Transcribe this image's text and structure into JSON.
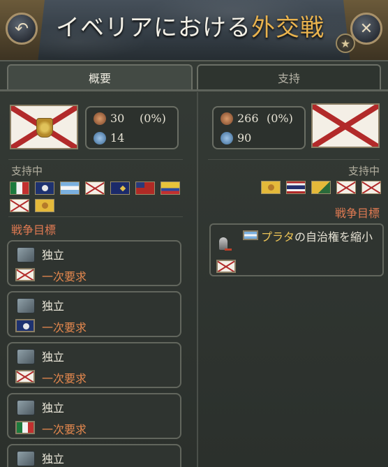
{
  "header": {
    "title_prefix": "イベリアにおける",
    "title_highlight": "外交戦",
    "back_glyph": "↶",
    "close_glyph": "✕",
    "star_glyph": "★"
  },
  "tabs": [
    {
      "label": "概要",
      "active": true
    },
    {
      "label": "支持",
      "active": false
    }
  ],
  "left_side": {
    "army": "30",
    "army_pct": "(0%)",
    "navy": "14",
    "supporters_label": "支持中",
    "supporter_flags": [
      "mexico",
      "navy",
      "argentina",
      "burgundy",
      "ensign",
      "redensign",
      "ecuador",
      "burgundy",
      "yellow"
    ],
    "wargoals_label": "戦争目標",
    "wargoals": [
      {
        "type": "独立",
        "demand": "一次要求",
        "flag": "burgundy"
      },
      {
        "type": "独立",
        "demand": "一次要求",
        "flag": "navy"
      },
      {
        "type": "独立",
        "demand": "一次要求",
        "flag": "burgundy"
      },
      {
        "type": "独立",
        "demand": "一次要求",
        "flag": "mexico"
      },
      {
        "type": "独立",
        "demand": "",
        "flag": ""
      }
    ]
  },
  "right_side": {
    "army": "266",
    "army_pct": "(0%)",
    "navy": "90",
    "supporters_label": "支持中",
    "supporter_flags": [
      "yellow",
      "thai",
      "yellow2",
      "burgundy",
      "burgundy"
    ],
    "wargoals_label": "戦争目標",
    "wargoal": {
      "target": "プラタ",
      "text": "の自治権を縮小"
    }
  },
  "colors": {
    "accent_orange": "#e07a52",
    "title_gold": "#e9b34e",
    "highlight_yellow": "#ebc356"
  }
}
